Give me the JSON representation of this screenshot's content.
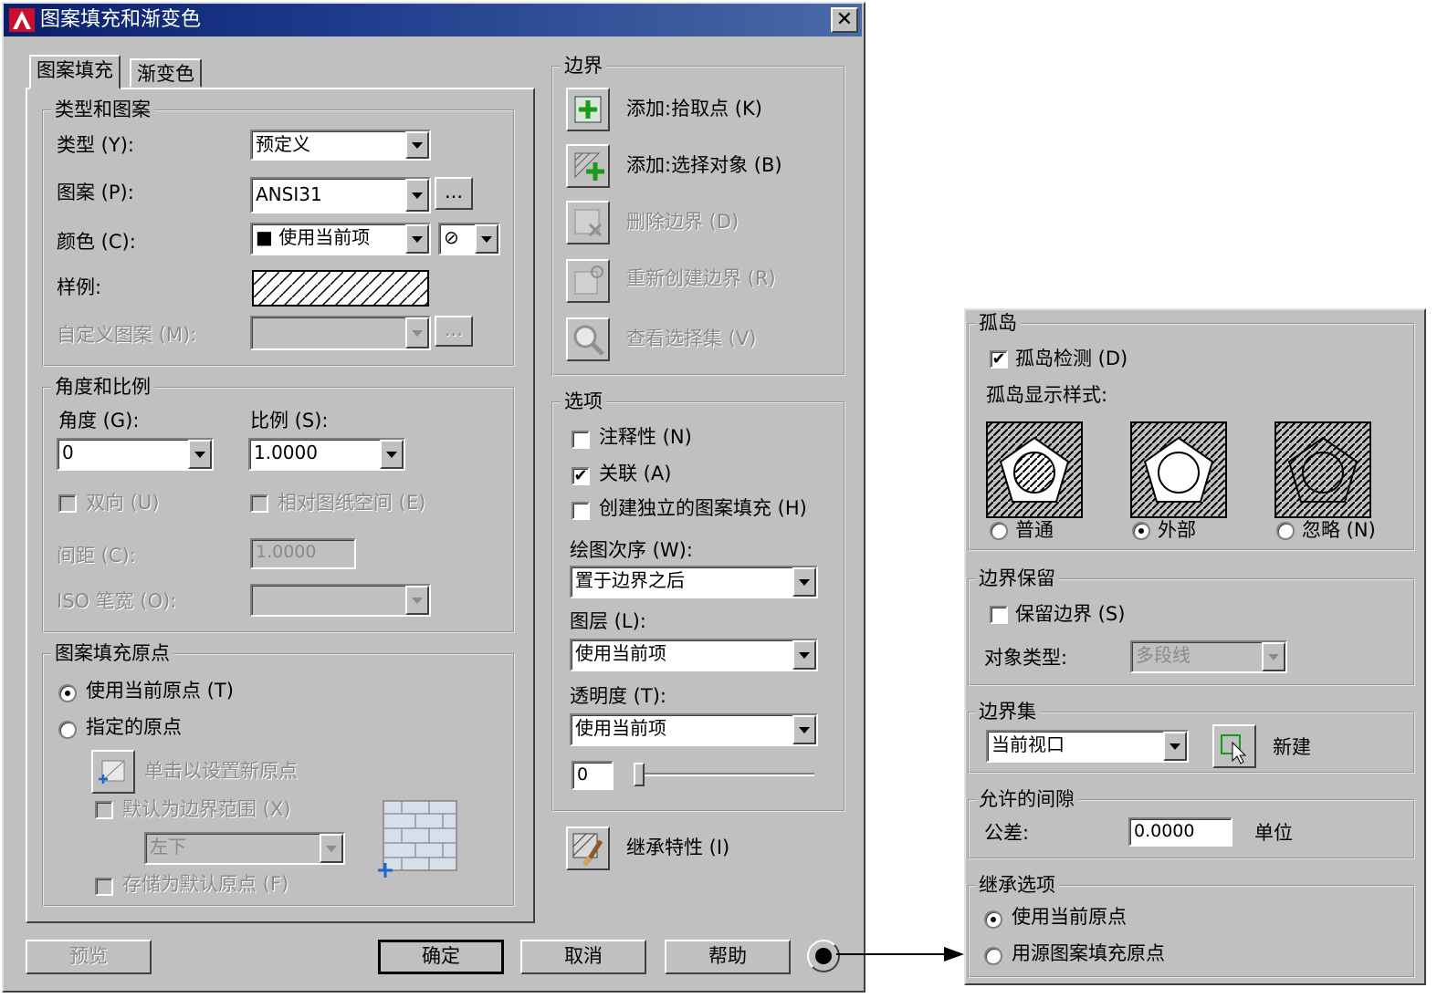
{
  "window": {
    "title": "图案填充和渐变色",
    "close": "✕"
  },
  "tabs": [
    "图案填充",
    "渐变色"
  ],
  "type_pattern": {
    "group": "类型和图案",
    "type_label": "类型 (Y):",
    "type_value": "预定义",
    "pattern_label": "图案 (P):",
    "pattern_value": "ANSI31",
    "ellipsis": "...",
    "color_label": "颜色 (C):",
    "color_value": "■ 使用当前项",
    "color_bg": "⊘",
    "sample_label": "样例:",
    "custom_label": "自定义图案 (M):"
  },
  "angle_scale": {
    "group": "角度和比例",
    "angle_label": "角度 (G):",
    "angle_value": "0",
    "scale_label": "比例 (S):",
    "scale_value": "1.0000",
    "double_label": "双向 (U)",
    "relative_label": "相对图纸空间 (E)",
    "spacing_label": "间距 (C):",
    "spacing_value": "1.0000",
    "iso_label": "ISO 笔宽 (O):"
  },
  "origin": {
    "group": "图案填充原点",
    "use_current": "使用当前原点 (T)",
    "specified": "指定的原点",
    "click_set": "单击以设置新原点",
    "default_extent": "默认为边界范围 (X)",
    "extent_value": "左下",
    "store_default": "存储为默认原点 (F)"
  },
  "boundary": {
    "group": "边界",
    "add_pick": "添加:拾取点 (K)",
    "add_select": "添加:选择对象 (B)",
    "remove": "删除边界 (D)",
    "recreate": "重新创建边界 (R)",
    "view": "查看选择集 (V)"
  },
  "options": {
    "group": "选项",
    "annotative": "注释性 (N)",
    "associative": "关联 (A)",
    "separate": "创建独立的图案填充 (H)",
    "draw_order_label": "绘图次序 (W):",
    "draw_order_value": "置于边界之后",
    "layer_label": "图层 (L):",
    "layer_value": "使用当前项",
    "transparency_label": "透明度 (T):",
    "transparency_value": "使用当前项",
    "transparency_num": "0"
  },
  "inherit": "继承特性 (I)",
  "buttons": {
    "preview": "预览",
    "ok": "确定",
    "cancel": "取消",
    "help": "帮助"
  },
  "islands": {
    "group": "孤岛",
    "detect": "孤岛检测 (D)",
    "style_label": "孤岛显示样式:",
    "normal": "普通",
    "outer": "外部",
    "ignore": "忽略 (N)"
  },
  "retain": {
    "group": "边界保留",
    "retain_label": "保留边界 (S)",
    "object_type_label": "对象类型:",
    "object_type_value": "多段线"
  },
  "boundary_set": {
    "group": "边界集",
    "value": "当前视口",
    "new_label": "新建"
  },
  "gap": {
    "group": "允许的间隙",
    "tolerance_label": "公差:",
    "tolerance_value": "0.0000",
    "unit": "单位"
  },
  "inherit_options": {
    "group": "继承选项",
    "use_current": "使用当前原点",
    "use_source": "用源图案填充原点"
  },
  "colors": {
    "title_start": "#0a1f6b",
    "dialog_bg": "#c0c0c0",
    "disabled_text": "#8a8a8a"
  }
}
